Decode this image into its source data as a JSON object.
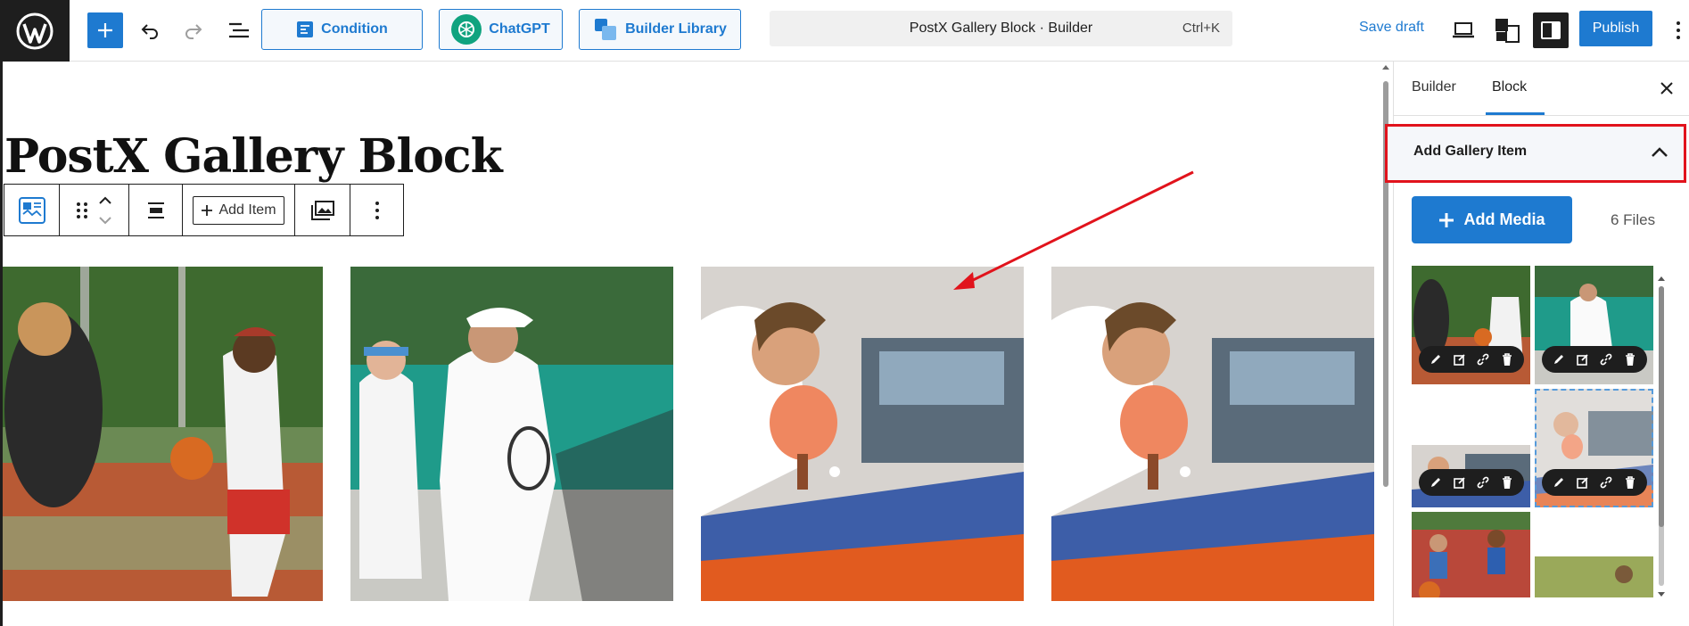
{
  "topbar": {
    "condition_label": "Condition",
    "chatgpt_label": "ChatGPT",
    "library_label": "Builder Library",
    "command_title": "PostX Gallery Block · Builder",
    "command_shortcut": "Ctrl+K",
    "save_draft_label": "Save draft",
    "publish_label": "Publish"
  },
  "editor": {
    "page_title": "PostX Gallery Block",
    "toolbar": {
      "add_item_label": "Add Item"
    }
  },
  "sidebar": {
    "tabs": [
      {
        "label": "Builder",
        "active": false
      },
      {
        "label": "Block",
        "active": true
      }
    ],
    "panel": {
      "title": "Add Gallery Item",
      "add_media_label": "Add Media",
      "files_count": "6 Files"
    }
  },
  "colors": {
    "accent": "#1e7ad0",
    "highlight": "#e1131c",
    "dark": "#1e1e1e"
  },
  "icons": [
    "wordpress-icon",
    "plus-icon",
    "undo-icon",
    "redo-icon",
    "list-view-icon",
    "condition-icon",
    "chatgpt-icon",
    "library-icon",
    "desktop-preview-icon",
    "styles-icon",
    "sidebar-toggle-icon",
    "more-icon",
    "close-icon",
    "chevron-up-icon",
    "edit-icon",
    "replace-icon",
    "link-icon",
    "trash-icon"
  ]
}
